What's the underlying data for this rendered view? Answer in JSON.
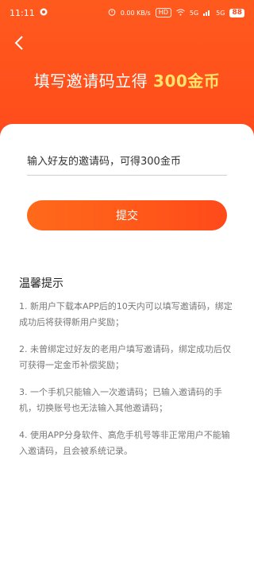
{
  "status_bar": {
    "time": "11:11",
    "network_speed": "0.00 KB/s",
    "hd_label": "HD",
    "signal_5g_1": "5G",
    "signal_5g_2": "5G",
    "battery": "88",
    "icons": [
      "notification-icon",
      "alarm-icon",
      "wifi-icon",
      "signal-icon"
    ]
  },
  "header": {
    "title_prefix": "填写邀请码立得 ",
    "title_amount": "300金币",
    "background_color": "#ff4a1a",
    "accent_color": "#ffe36a"
  },
  "form": {
    "invite_input_value": "",
    "invite_input_placeholder": "输入好友的邀请码，可得300金币",
    "submit_label": "提交"
  },
  "tips": {
    "title": "温馨提示",
    "items": [
      "1. 新用户下载本APP后的10天内可以填写邀请码，绑定成功后将获得新用户奖励；",
      "2. 未曾绑定过好友的老用户填写邀请码，绑定成功后仅可获得一定金币补偿奖励；",
      "3. 一个手机只能输入一次邀请码；已输入邀请码的手机，切换账号也无法输入其他邀请码；",
      "4. 使用APP分身软件、高危手机号等非正常用户不能输入邀请码，且会被系统记录。"
    ]
  }
}
